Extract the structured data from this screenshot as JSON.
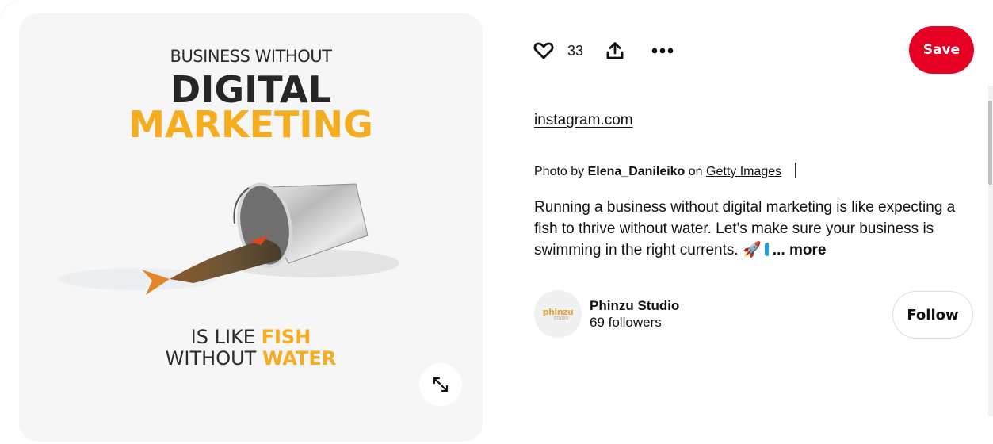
{
  "pin_image": {
    "line1": "BUSINESS WITHOUT",
    "line2": "DIGITAL",
    "line3": "MARKETING",
    "line4_prefix": "IS LIKE",
    "line4_highlight": "FISH",
    "line5_prefix": "WITHOUT",
    "line5_highlight": "WATER",
    "accent_color": "#f5ac1e",
    "expand_icon": "expand-arrows-icon"
  },
  "actions": {
    "like_icon": "heart-icon",
    "like_count": "33",
    "share_icon": "share-upload-icon",
    "more_icon": "ellipsis-icon",
    "save_label": "Save",
    "save_color": "#e60023"
  },
  "source": {
    "link_text": "instagram.com"
  },
  "credit": {
    "prefix": "Photo by",
    "author": "Elena_Danileiko",
    "on": "on",
    "provider": "Getty Images"
  },
  "description": {
    "text": "Running a business without digital marketing is like expecting a fish to thrive without water. Let's make sure your business is swimming in the right currents.",
    "emoji_rocket": "🚀",
    "more_label": "... more"
  },
  "creator": {
    "avatar_logo": "phinzu",
    "avatar_sub": "STUDIO",
    "name": "Phinzu Studio",
    "followers": "69 followers",
    "follow_label": "Follow"
  }
}
